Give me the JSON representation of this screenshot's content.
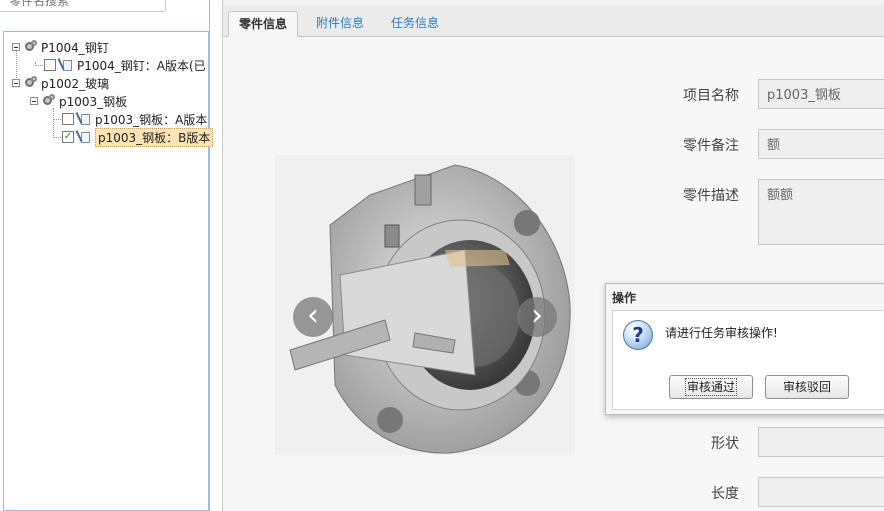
{
  "tree": {
    "search_placeholder": "零件名搜索",
    "nodes": [
      {
        "label": "P1004_钢钉"
      },
      {
        "label": "P1004_钢钉：A版本(已"
      },
      {
        "label": "p1002_玻璃"
      },
      {
        "label": "p1003_钢板"
      },
      {
        "label": "p1003_钢板：A版本"
      },
      {
        "label": "p1003_钢板：B版本"
      }
    ],
    "checkmark": "✓"
  },
  "tabs": [
    {
      "label": "零件信息"
    },
    {
      "label": "附件信息"
    },
    {
      "label": "任务信息"
    }
  ],
  "form": {
    "project_name": {
      "label": "项目名称",
      "value": "p1003_钢板"
    },
    "part_note": {
      "label": "零件备注",
      "value": "额"
    },
    "part_desc": {
      "label": "零件描述",
      "value": "额额"
    },
    "shape": {
      "label": "形状",
      "value": ""
    },
    "length": {
      "label": "长度",
      "value": ""
    }
  },
  "carousel": {
    "prev_glyph": "‹",
    "next_glyph": "›"
  },
  "dialog": {
    "title": "操作",
    "icon": "?",
    "message": "请进行任务审核操作!",
    "approve_label": "审核通过",
    "reject_label": "审核驳回"
  }
}
